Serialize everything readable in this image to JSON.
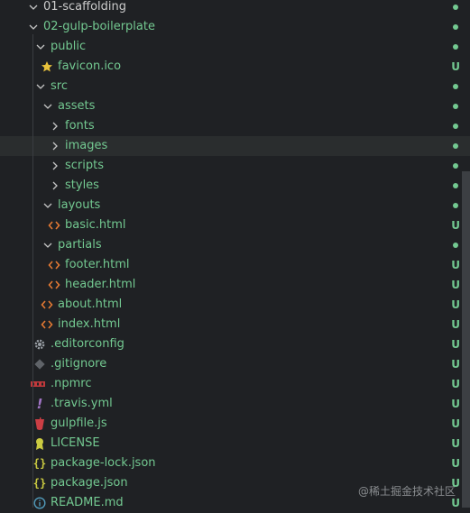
{
  "colors": {
    "tracked": "#73c991",
    "untracked_badge": "#73c991",
    "modified_dot": "#73c991"
  },
  "rows": [
    {
      "label": "01-scaffolding",
      "type": "folder",
      "state": "open",
      "badge": "dot",
      "color": "#cccccc"
    },
    {
      "label": "02-gulp-boilerplate",
      "type": "folder",
      "state": "open",
      "badge": "dot",
      "color": "#73c991"
    },
    {
      "label": "public",
      "type": "folder",
      "state": "open",
      "badge": "dot",
      "color": "#73c991"
    },
    {
      "label": "favicon.ico",
      "type": "file",
      "icon": "star-icon",
      "badge": "U",
      "color": "#73c991"
    },
    {
      "label": "src",
      "type": "folder",
      "state": "open",
      "badge": "dot",
      "color": "#73c991"
    },
    {
      "label": "assets",
      "type": "folder",
      "state": "open",
      "badge": "dot",
      "color": "#73c991"
    },
    {
      "label": "fonts",
      "type": "folder",
      "state": "closed",
      "badge": "dot",
      "color": "#73c991"
    },
    {
      "label": "images",
      "type": "folder",
      "state": "closed",
      "badge": "dot",
      "color": "#73c991"
    },
    {
      "label": "scripts",
      "type": "folder",
      "state": "closed",
      "badge": "dot",
      "color": "#73c991"
    },
    {
      "label": "styles",
      "type": "folder",
      "state": "closed",
      "badge": "dot",
      "color": "#73c991"
    },
    {
      "label": "layouts",
      "type": "folder",
      "state": "open",
      "badge": "dot",
      "color": "#73c991"
    },
    {
      "label": "basic.html",
      "type": "file",
      "icon": "html-icon",
      "badge": "U",
      "color": "#73c991"
    },
    {
      "label": "partials",
      "type": "folder",
      "state": "open",
      "badge": "dot",
      "color": "#73c991"
    },
    {
      "label": "footer.html",
      "type": "file",
      "icon": "html-icon",
      "badge": "U",
      "color": "#73c991"
    },
    {
      "label": "header.html",
      "type": "file",
      "icon": "html-icon",
      "badge": "U",
      "color": "#73c991"
    },
    {
      "label": "about.html",
      "type": "file",
      "icon": "html-icon",
      "badge": "U",
      "color": "#73c991"
    },
    {
      "label": "index.html",
      "type": "file",
      "icon": "html-icon",
      "badge": "U",
      "color": "#73c991"
    },
    {
      "label": ".editorconfig",
      "type": "file",
      "icon": "gear-icon",
      "badge": "U",
      "color": "#73c991"
    },
    {
      "label": ".gitignore",
      "type": "file",
      "icon": "git-icon",
      "badge": "U",
      "color": "#73c991"
    },
    {
      "label": ".npmrc",
      "type": "file",
      "icon": "npm-icon",
      "badge": "U",
      "color": "#73c991"
    },
    {
      "label": ".travis.yml",
      "type": "file",
      "icon": "exclamation-icon",
      "badge": "U",
      "color": "#73c991"
    },
    {
      "label": "gulpfile.js",
      "type": "file",
      "icon": "gulp-icon",
      "badge": "U",
      "color": "#73c991"
    },
    {
      "label": "LICENSE",
      "type": "file",
      "icon": "license-icon",
      "badge": "U",
      "color": "#73c991"
    },
    {
      "label": "package-lock.json",
      "type": "file",
      "icon": "json-icon",
      "badge": "U",
      "color": "#73c991"
    },
    {
      "label": "package.json",
      "type": "file",
      "icon": "json-icon",
      "badge": "U",
      "color": "#73c991"
    },
    {
      "label": "README.md",
      "type": "file",
      "icon": "info-icon",
      "badge": "U",
      "color": "#73c991"
    }
  ],
  "watermark": "@稀土掘金技术社区"
}
